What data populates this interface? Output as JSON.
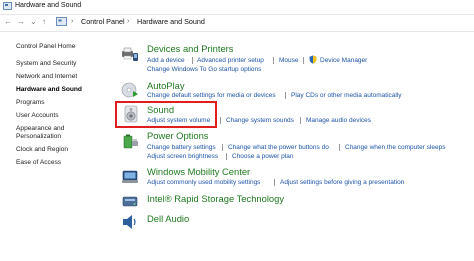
{
  "window": {
    "title": "Hardware and Sound"
  },
  "address": {
    "crumbs": [
      "Control Panel",
      "Hardware and Sound"
    ]
  },
  "sidebar": {
    "items": [
      {
        "label": "Control Panel Home"
      },
      {
        "label": "System and Security"
      },
      {
        "label": "Network and Internet"
      },
      {
        "label": "Hardware and Sound",
        "active": true
      },
      {
        "label": "Programs"
      },
      {
        "label": "User Accounts"
      },
      {
        "label": "Appearance and"
      },
      {
        "label": "Personalization"
      },
      {
        "label": "Clock and Region"
      },
      {
        "label": "Ease of Access"
      }
    ]
  },
  "categories": {
    "devices": {
      "title": "Devices and Printers",
      "icon": "printer-icon",
      "links": [
        "Add a device",
        "Advanced printer setup",
        "Mouse",
        "Device Manager",
        "Change Windows To Go startup options"
      ]
    },
    "autoplay": {
      "title": "AutoPlay",
      "icon": "autoplay-icon",
      "links": [
        "Change default settings for media or devices",
        "Play CDs or other media automatically"
      ]
    },
    "sound": {
      "title": "Sound",
      "icon": "speaker-icon",
      "links": [
        "Adjust system volume",
        "Change system sounds",
        "Manage audio devices"
      ]
    },
    "power": {
      "title": "Power Options",
      "icon": "battery-icon",
      "links": [
        "Change battery settings",
        "Change what the power buttons do",
        "Change when the computer sleeps",
        "Adjust screen brightness",
        "Choose a power plan"
      ]
    },
    "mobility": {
      "title": "Windows Mobility Center",
      "icon": "mobility-center-icon",
      "links": [
        "Adjust commonly used mobility settings",
        "Adjust settings before giving a presentation"
      ]
    },
    "storage": {
      "title": "Intel® Rapid Storage Technology",
      "icon": "storage-icon"
    },
    "dellaudio": {
      "title": "Dell Audio",
      "icon": "dell-audio-icon"
    }
  },
  "colors": {
    "category_title": "#1f7a1f",
    "link": "#1d54a8",
    "highlight_border": "#e01e1e"
  }
}
